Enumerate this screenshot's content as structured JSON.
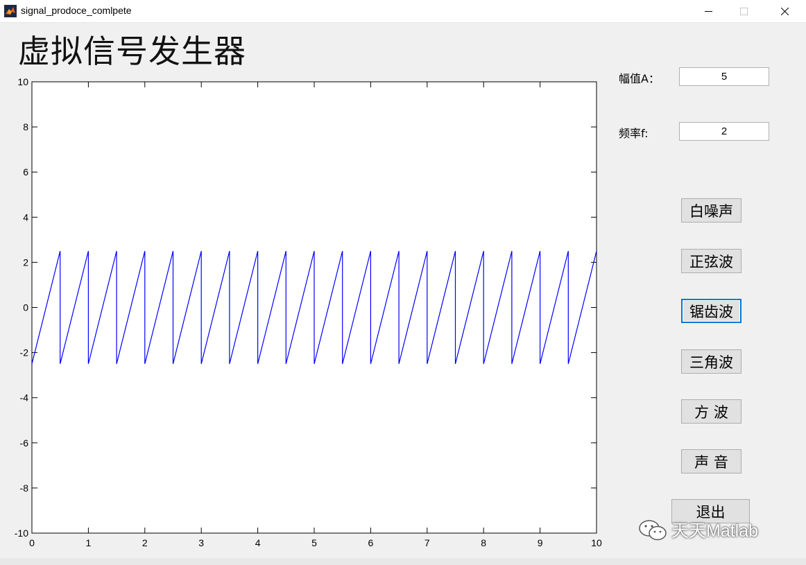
{
  "window": {
    "title": "signal_prodoce_comlpete",
    "icon": "matlab-icon",
    "controls": [
      "minimize-icon",
      "maximize-icon",
      "close-icon"
    ]
  },
  "heading": "虚拟信号发生器",
  "amplitude": {
    "label": "幅值A：",
    "value": "5"
  },
  "frequency": {
    "label": "频率f:",
    "value": "2"
  },
  "buttons": {
    "white_noise": "白噪声",
    "sine": "正弦波",
    "sawtooth": "锯齿波",
    "triangle": "三角波",
    "square": "方 波",
    "sound": "声 音",
    "exit": "退出"
  },
  "watermark": "天天Matlab",
  "colors": {
    "signal": "#0000ff",
    "focus": "#0078d7",
    "background": "#f0f0f0"
  },
  "chart_data": {
    "type": "line",
    "title": "",
    "xlabel": "",
    "ylabel": "",
    "xlim": [
      0,
      10
    ],
    "ylim": [
      -10,
      10
    ],
    "xticks": [
      "0",
      "1",
      "2",
      "3",
      "4",
      "5",
      "6",
      "7",
      "8",
      "9",
      "10"
    ],
    "yticks": [
      "10",
      "8",
      "6",
      "4",
      "2",
      "0",
      "-2",
      "-4",
      "-6",
      "-8",
      "-10"
    ],
    "grid": false,
    "series": [
      {
        "waveform": "sawtooth",
        "period": 0.5,
        "min": -2.5,
        "max": 2.5,
        "x": [
          0,
          0.5,
          0.5,
          1,
          1,
          1.5,
          1.5,
          2,
          2,
          2.5,
          2.5,
          3,
          3,
          3.5,
          3.5,
          4,
          4,
          4.5,
          4.5,
          5,
          5,
          5.5,
          5.5,
          6,
          6,
          6.5,
          6.5,
          7,
          7,
          7.5,
          7.5,
          8,
          8,
          8.5,
          8.5,
          9,
          9,
          9.5,
          9.5,
          10
        ],
        "y": [
          -2.5,
          2.5,
          -2.5,
          2.5,
          -2.5,
          2.5,
          -2.5,
          2.5,
          -2.5,
          2.5,
          -2.5,
          2.5,
          -2.5,
          2.5,
          -2.5,
          2.5,
          -2.5,
          2.5,
          -2.5,
          2.5,
          -2.5,
          2.5,
          -2.5,
          2.5,
          -2.5,
          2.5,
          -2.5,
          2.5,
          -2.5,
          2.5,
          -2.5,
          2.5,
          -2.5,
          2.5,
          -2.5,
          2.5,
          -2.5,
          2.5,
          -2.5,
          2.5
        ]
      }
    ]
  }
}
